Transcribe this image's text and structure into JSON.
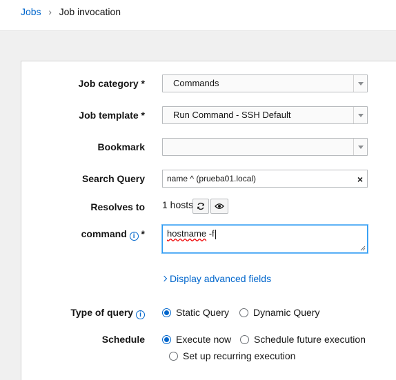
{
  "breadcrumb": {
    "parent": "Jobs",
    "separator": "›",
    "current": "Job invocation"
  },
  "form": {
    "job_category": {
      "label": "Job category *",
      "value": "Commands"
    },
    "job_template": {
      "label": "Job template *",
      "value": "Run Command - SSH Default"
    },
    "bookmark": {
      "label": "Bookmark",
      "value": ""
    },
    "search_query": {
      "label": "Search Query",
      "value": "name ^ (prueba01.local)",
      "clear_glyph": "×"
    },
    "resolves_to": {
      "label": "Resolves to",
      "value": "1 hosts"
    },
    "command": {
      "label": "command",
      "required_mark": "*",
      "value_word": "hostname",
      "value_rest": " -f"
    },
    "advanced_link": "Display advanced fields",
    "type_of_query": {
      "label": "Type of query",
      "options": [
        "Static Query",
        "Dynamic Query"
      ],
      "selected": "Static Query"
    },
    "schedule": {
      "label": "Schedule",
      "options": [
        "Execute now",
        "Schedule future execution",
        "Set up recurring execution"
      ],
      "selected": "Execute now"
    }
  },
  "icons": {
    "select_arrow": "caret-down-icon",
    "refresh": "refresh-icon",
    "preview": "eye-icon",
    "info": "info-icon",
    "clear": "close-icon"
  },
  "colors": {
    "link": "#0066cc",
    "focus_border": "#2b9af3",
    "radio_selected": "#0066cc"
  }
}
